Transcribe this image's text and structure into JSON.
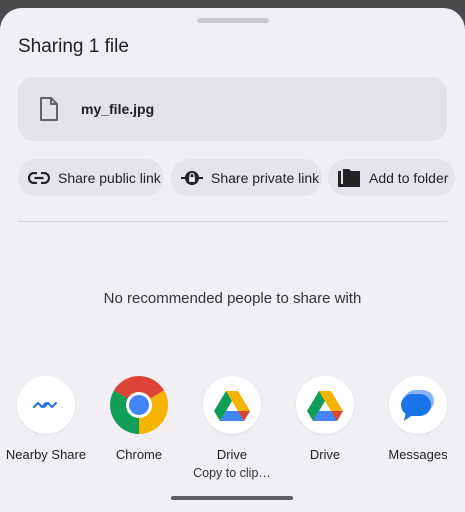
{
  "sheet": {
    "title": "Sharing 1 file"
  },
  "file": {
    "name": "my_file.jpg",
    "icon": "document-icon"
  },
  "actions": [
    {
      "label": "Share public link",
      "icon": "link-icon"
    },
    {
      "label": "Share private link",
      "icon": "lock-link-icon"
    },
    {
      "label": "Add to folder",
      "icon": "folder-icon"
    }
  ],
  "people": {
    "empty_message": "No recommended people to share with"
  },
  "apps": [
    {
      "label": "Nearby Share",
      "sub": "",
      "icon": "nearby-share-icon"
    },
    {
      "label": "Chrome",
      "sub": "",
      "icon": "chrome-icon"
    },
    {
      "label": "Drive",
      "sub": "Copy to clip…",
      "icon": "drive-icon"
    },
    {
      "label": "Drive",
      "sub": "",
      "icon": "drive-icon"
    },
    {
      "label": "Messages",
      "sub": "",
      "icon": "messages-icon"
    }
  ],
  "colors": {
    "sheet_bg": "#f1eff4",
    "chip_bg": "#e6e4ea",
    "nearby_blue": "#1a73e8",
    "chrome_red": "#db4437",
    "chrome_yellow": "#f4b400",
    "chrome_green": "#0f9d58",
    "chrome_blue": "#4285f4",
    "messages_blue": "#1a73e8"
  }
}
